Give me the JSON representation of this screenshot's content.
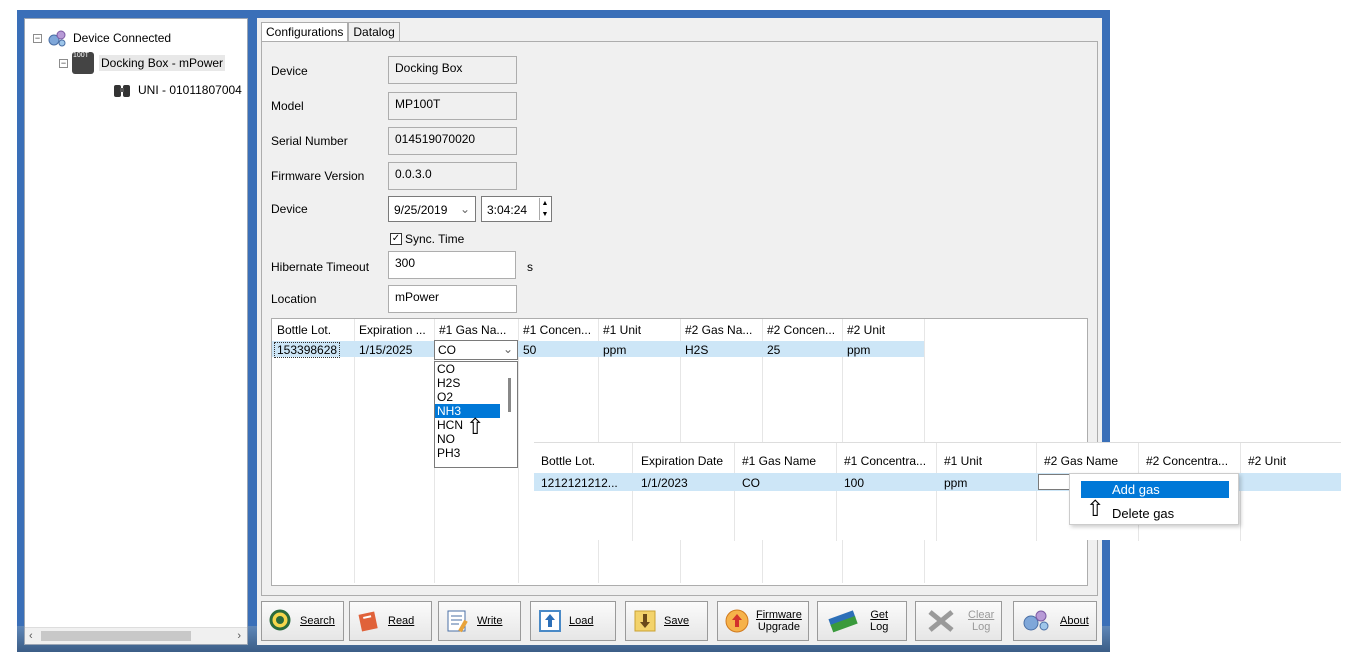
{
  "tree": {
    "root": "Device Connected",
    "child": "Docking Box - mPower",
    "grandchild": "UNI - 01011807004",
    "child_badge": "100T"
  },
  "tabs": [
    "Configurations",
    "Datalog"
  ],
  "form": {
    "device_label": "Device",
    "device_value": "Docking Box",
    "model_label": "Model",
    "model_value": "MP100T",
    "serial_label": "Serial Number",
    "serial_value": "014519070020",
    "firmware_label": "Firmware Version",
    "firmware_value": "0.0.3.0",
    "date_label": "Device",
    "date_value": "9/25/2019",
    "time_value": "3:04:24",
    "sync_label": "Sync. Time",
    "hibernate_label": "Hibernate Timeout",
    "hibernate_value": "300",
    "hibernate_unit": "s",
    "location_label": "Location",
    "location_value": "mPower"
  },
  "grid": {
    "headers": [
      "Bottle Lot.",
      "Expiration ...",
      "#1 Gas Na...",
      "#1 Concen...",
      "#1 Unit",
      "#2 Gas Na...",
      "#2 Concen...",
      "#2 Unit"
    ],
    "row": [
      "153398628",
      "1/15/2025",
      "CO",
      "50",
      "ppm",
      "H2S",
      "25",
      "ppm"
    ]
  },
  "dropdown": {
    "selected": "CO",
    "options": [
      "CO",
      "H2S",
      "O2",
      "NH3",
      "HCN",
      "NO",
      "PH3"
    ],
    "highlighted": "NH3"
  },
  "grid2": {
    "headers": [
      "Bottle Lot.",
      "Expiration Date",
      "#1 Gas Name",
      "#1 Concentra...",
      "#1 Unit",
      "#2 Gas Name",
      "#2 Concentra...",
      "#2 Unit"
    ],
    "row": [
      "1212121212...",
      "1/1/2023",
      "CO",
      "100",
      "ppm"
    ]
  },
  "context_menu": {
    "add": "Add gas",
    "delete": "Delete gas"
  },
  "toolbar": {
    "search": "Search",
    "read": "Read",
    "write": "Write",
    "load": "Load",
    "save": "Save",
    "firmware_1": "Firmware",
    "firmware_2": "Upgrade",
    "getlog_1": "Get",
    "getlog_2": "Log",
    "clearlog_1": "Clear",
    "clearlog_2": "Log",
    "about": "About"
  },
  "colors": {
    "window_frame": "#3a6fb8",
    "selection": "#0078d7",
    "row_highlight": "#cde6f7"
  }
}
